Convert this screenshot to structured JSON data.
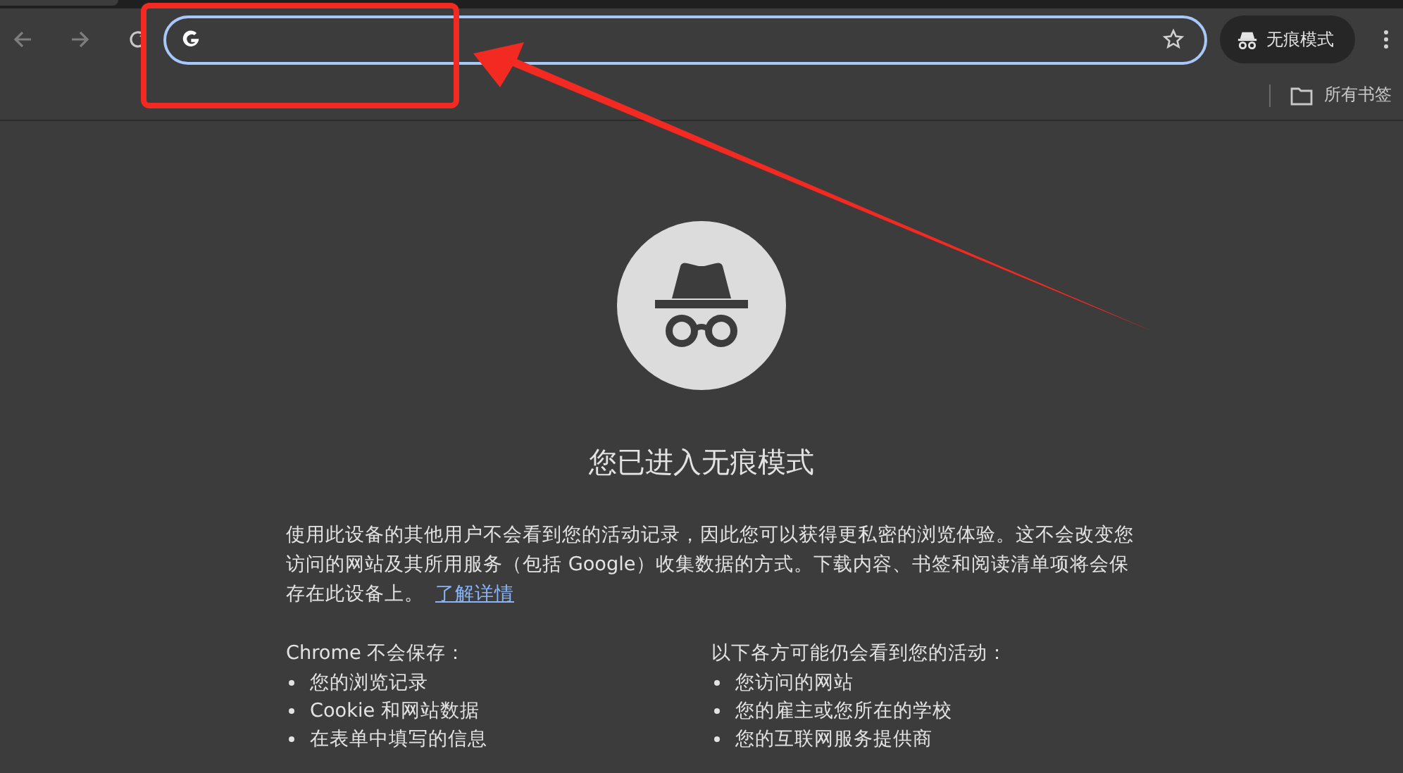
{
  "toolbar": {
    "incognito_chip": "无痕模式"
  },
  "bookmarks_bar": {
    "all_bookmarks": "所有书签"
  },
  "page": {
    "title": "您已进入无痕模式",
    "paragraph": "使用此设备的其他用户不会看到您的活动记录，因此您可以获得更私密的浏览体验。这不会改变您访问的网站及其所用服务（包括 Google）收集数据的方式。下载内容、书签和阅读清单项将会保存在此设备上。",
    "link": "了解详情",
    "columns": [
      {
        "heading": "Chrome 不会保存：",
        "items": [
          "您的浏览记录",
          "Cookie 和网站数据",
          "在表单中填写的信息"
        ]
      },
      {
        "heading": "以下各方可能仍会看到您的活动：",
        "items": [
          "您访问的网站",
          "您的雇主或您所在的学校",
          "您的互联网服务提供商"
        ]
      }
    ]
  }
}
